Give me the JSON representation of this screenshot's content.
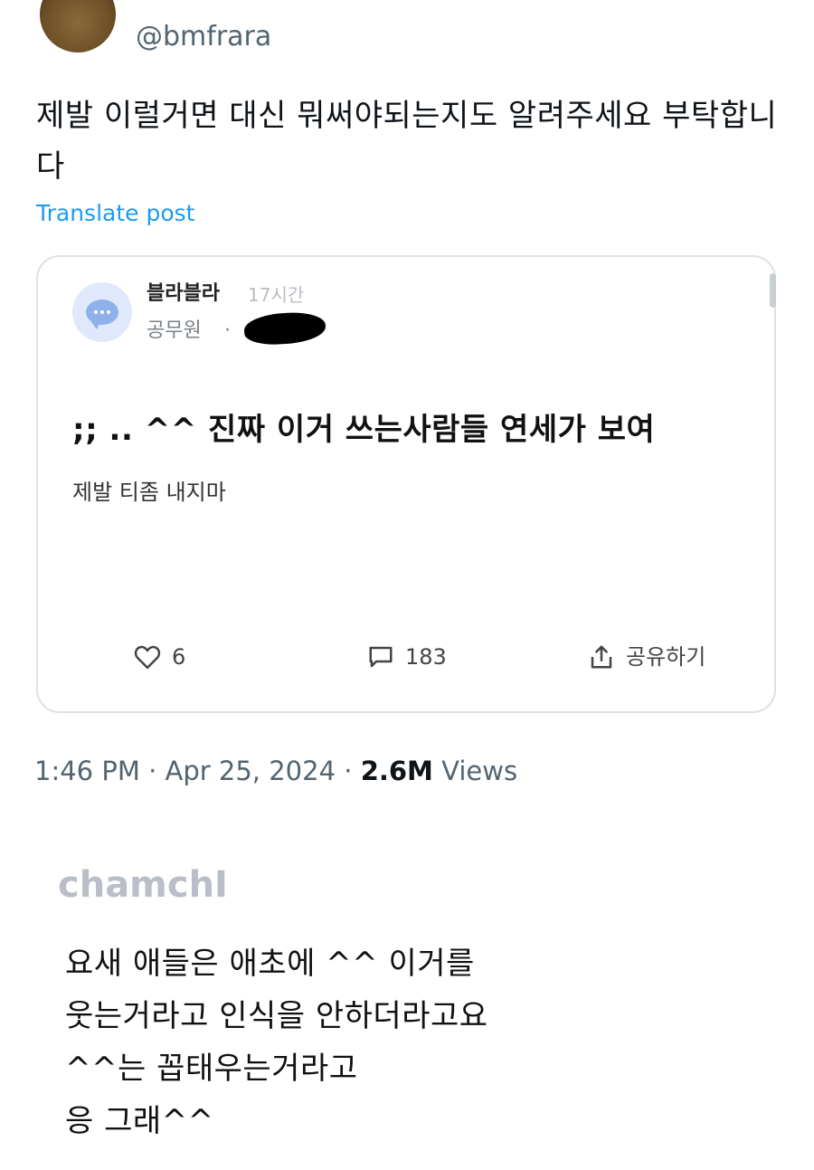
{
  "post": {
    "handle": "@bmfrara",
    "text": "제발 이럴거면 대신 뭐써야되는지도 알려주세요 부탁합니다",
    "translate_label": "Translate post",
    "timestamp": "1:46 PM · Apr 25, 2024 · ",
    "views_count": "2.6M",
    "views_label": " Views"
  },
  "quote": {
    "author": "블라블라",
    "time": "17시간",
    "job": "공무원",
    "dot": "·",
    "title": ";; .. ^^ 진짜 이거 쓰는사람들 연세가 보여",
    "body": "제발 티좀 내지마",
    "likes": "6",
    "comments": "183",
    "share_label": "공유하기"
  },
  "comment": {
    "author": "chamchI",
    "lines": [
      "요새 애들은 애초에 ^^ 이거를",
      "웃는거라고 인식을 안하더라고요",
      "^^는 꼽태우는거라고",
      "응 그래^^"
    ]
  },
  "icons": {
    "avatar": "profile-avatar",
    "quote_avatar": "chat-bubble-icon",
    "like": "heart-icon",
    "comment": "comment-icon",
    "share": "share-icon"
  },
  "colors": {
    "link": "#1d9bf0",
    "muted": "#536471",
    "card_border": "#dbe1e6",
    "commenter": "#b9bec8"
  }
}
